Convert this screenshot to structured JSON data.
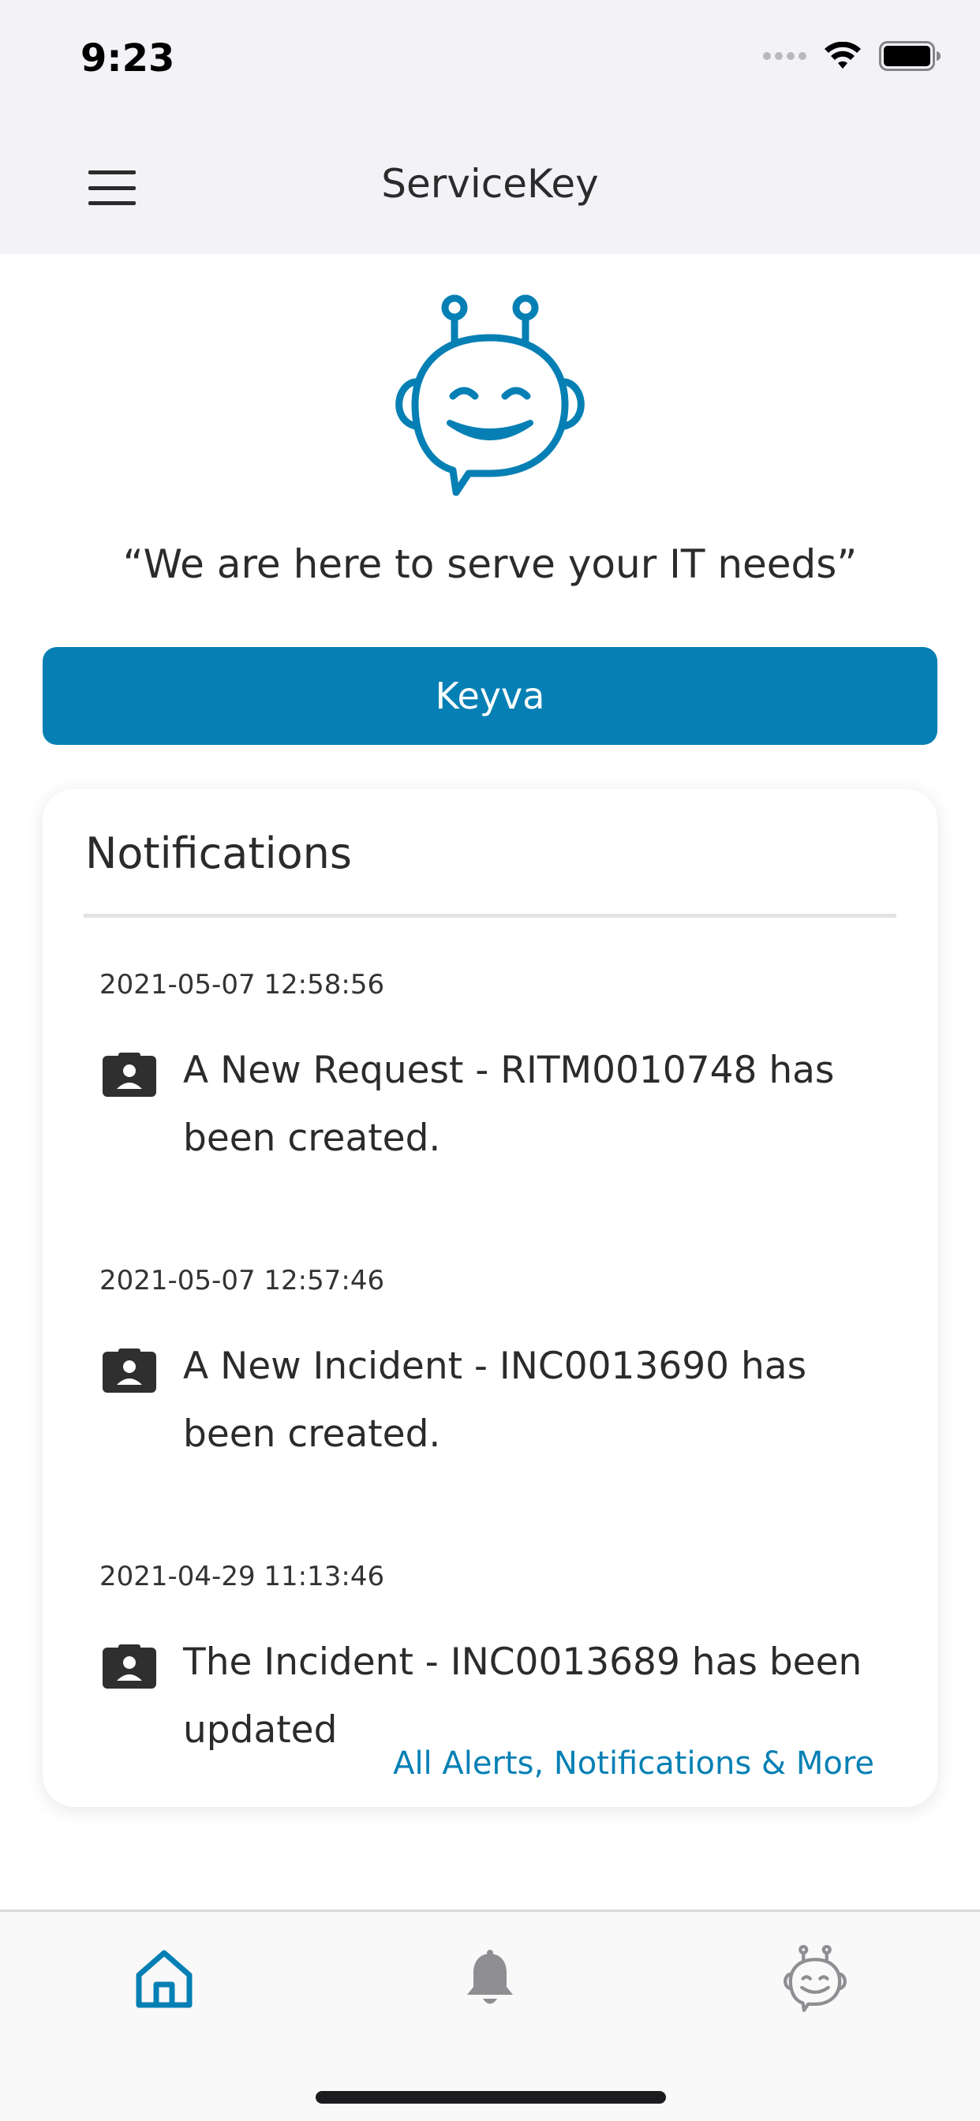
{
  "status_bar": {
    "time": "9:23"
  },
  "nav": {
    "title": "ServiceKey"
  },
  "hero": {
    "tagline": "“We are here to serve your IT needs”"
  },
  "keyva_button": {
    "label": "Keyva"
  },
  "notifications": {
    "title": "Notifications",
    "items": [
      {
        "timestamp": "2021-05-07 12:58:56",
        "message": "A New Request - RITM0010748 has been created."
      },
      {
        "timestamp": "2021-05-07 12:57:46",
        "message": "A New Incident - INC0013690 has been created."
      },
      {
        "timestamp": "2021-04-29 11:13:46",
        "message": "The Incident - INC0013689 has been updated"
      }
    ],
    "more_link": "All Alerts, Notifications & More"
  },
  "tabs": [
    {
      "icon": "home-icon",
      "active": true
    },
    {
      "icon": "bell-icon",
      "active": false
    },
    {
      "icon": "robot-icon",
      "active": false
    }
  ],
  "colors": {
    "accent": "#0680b4",
    "text": "#2b2b2b",
    "inactive_icon": "#8e8e93"
  }
}
